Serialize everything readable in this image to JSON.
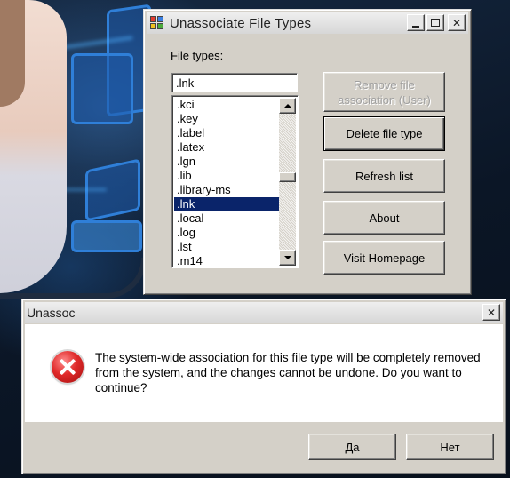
{
  "main_window": {
    "title": "Unassociate File Types",
    "file_types_label": "File types:",
    "input_value": ".lnk",
    "list_items": [
      ".kci",
      ".key",
      ".label",
      ".latex",
      ".lgn",
      ".lib",
      ".library-ms",
      ".lnk",
      ".local",
      ".log",
      ".lst",
      ".m14"
    ],
    "selected_item": ".lnk",
    "buttons": {
      "remove_association": "Remove file association (User)",
      "delete_file_type": "Delete file type",
      "refresh_list": "Refresh list",
      "about": "About",
      "visit_homepage": "Visit Homepage"
    },
    "caption_icons": {
      "minimize": "minimize-icon",
      "maximize": "maximize-icon",
      "close": "close-icon"
    }
  },
  "dialog": {
    "title": "Unassoc",
    "message": "The system-wide association for this file type will be completely removed from the system, and the changes cannot be undone. Do you want to continue?",
    "icon": "error-icon",
    "buttons": {
      "yes": "Да",
      "no": "Нет"
    }
  },
  "colors": {
    "selection": "#0a246a",
    "window_face": "#d4d0c8",
    "error_red": "#d22222"
  }
}
